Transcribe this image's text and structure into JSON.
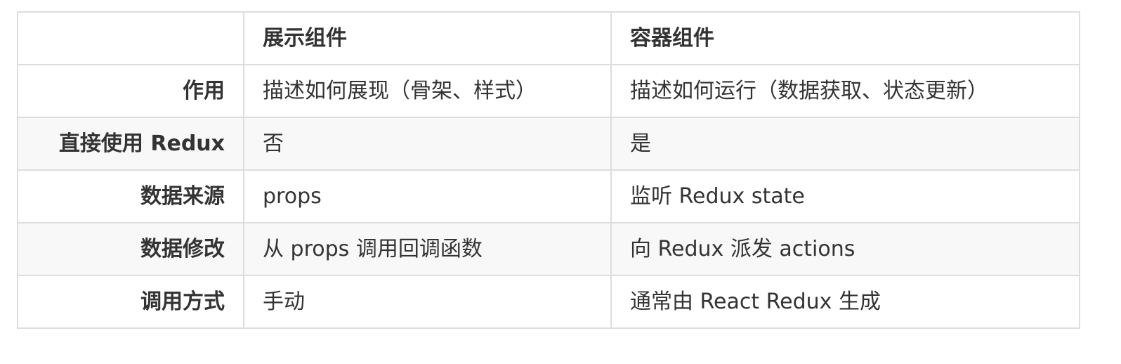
{
  "table": {
    "headers": [
      "",
      "展示组件",
      "容器组件"
    ],
    "rows": [
      [
        "作用",
        "描述如何展现（骨架、样式）",
        "描述如何运行（数据获取、状态更新）"
      ],
      [
        "直接使用 Redux",
        "否",
        "是"
      ],
      [
        "数据来源",
        "props",
        "监听 Redux state"
      ],
      [
        "数据修改",
        "从 props 调用回调函数",
        "向 Redux 派发 actions"
      ],
      [
        "调用方式",
        "手动",
        "通常由 React Redux 生成"
      ]
    ]
  }
}
